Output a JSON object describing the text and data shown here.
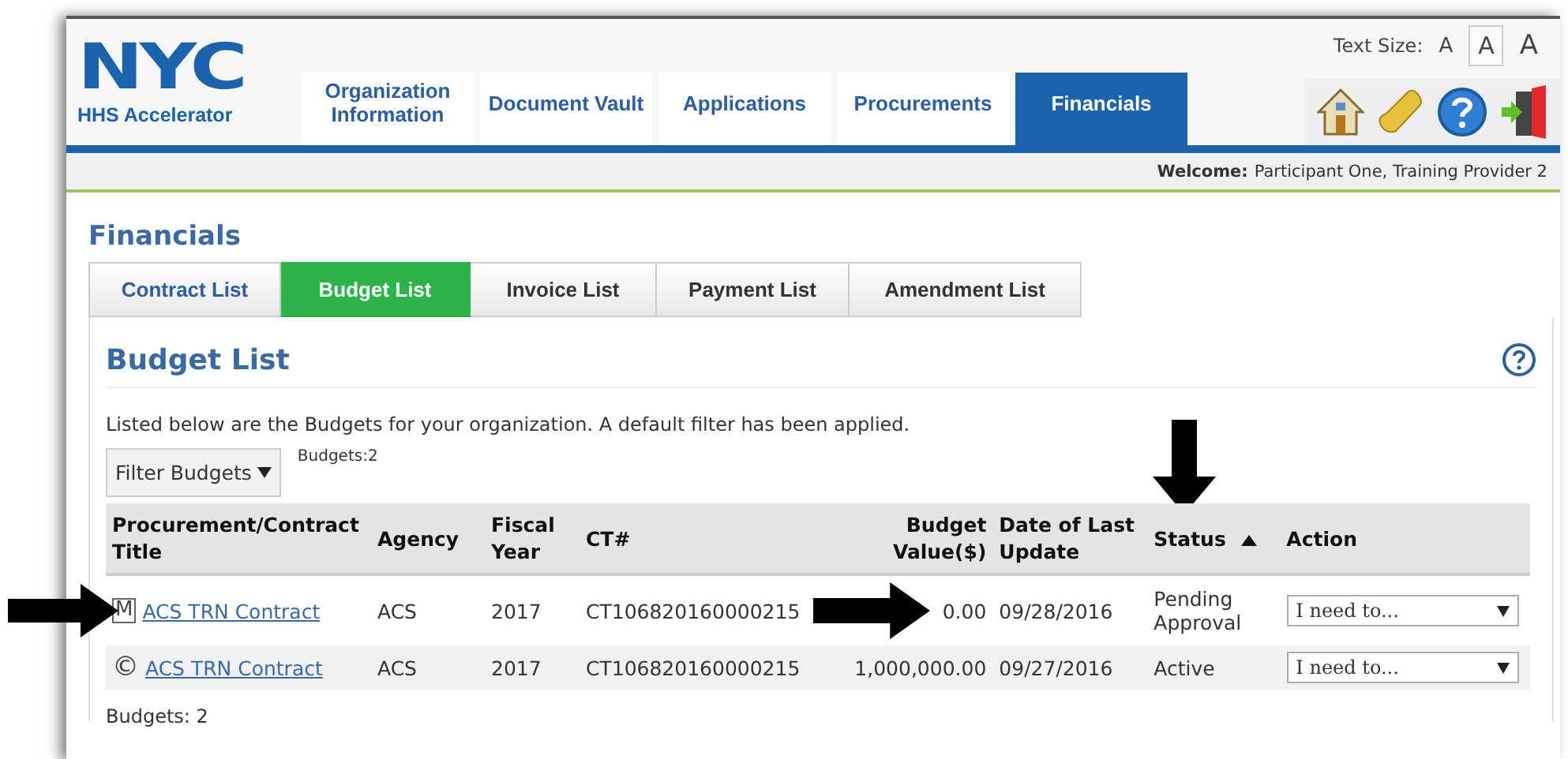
{
  "header": {
    "logo": {
      "mark": "NYC",
      "subtitle": "HHS Accelerator"
    },
    "text_size": {
      "label": "Text Size:",
      "options": [
        {
          "label": "A",
          "selected": false
        },
        {
          "label": "A",
          "selected": true
        },
        {
          "label": "A",
          "selected": false
        }
      ]
    },
    "nav_tabs": [
      {
        "label": "Organization Information",
        "selected": false
      },
      {
        "label": "Document Vault",
        "selected": false
      },
      {
        "label": "Applications",
        "selected": false
      },
      {
        "label": "Procurements",
        "selected": false
      },
      {
        "label": "Financials",
        "selected": true
      }
    ],
    "welcome": {
      "label": "Welcome:",
      "name": "Participant One,  Training Provider 2"
    }
  },
  "page_title": "Financials",
  "sub_tabs": [
    {
      "label": "Contract List",
      "selected": false
    },
    {
      "label": "Budget List",
      "selected": true
    },
    {
      "label": "Invoice List",
      "selected": false
    },
    {
      "label": "Payment List",
      "selected": false
    },
    {
      "label": "Amendment List",
      "selected": false
    }
  ],
  "section": {
    "title": "Budget List",
    "intro": "Listed below are the Budgets for your organization. A default filter has been applied.",
    "filter_button": "Filter Budgets",
    "count": "Budgets:2"
  },
  "table": {
    "columns": [
      {
        "label": "Procurement/Contract Title",
        "sorted": false
      },
      {
        "label": "Agency",
        "sorted": false
      },
      {
        "label": "Fiscal Year",
        "sorted": false
      },
      {
        "label": "CT#",
        "sorted": false
      },
      {
        "label": "Budget Value($)",
        "sorted": false
      },
      {
        "label": "Date of Last Update",
        "sorted": false
      },
      {
        "label": "Status",
        "sorted": true
      },
      {
        "label": "Action",
        "sorted": false
      }
    ],
    "rows": [
      {
        "kind": "boxed",
        "mark": "M",
        "title": "ACS TRN Contract",
        "agency": "ACS",
        "fiscal_year": "2017",
        "ct": "CT106820160000215",
        "value": "0.00",
        "date": "09/28/2016",
        "status": "Pending Approval",
        "action": "I need to..."
      },
      {
        "kind": "circled",
        "mark": "©",
        "title": "ACS TRN Contract",
        "agency": "ACS",
        "fiscal_year": "2017",
        "ct": "CT106820160000215",
        "value": "1,000,000.00",
        "date": "09/27/2016",
        "status": "Active",
        "action": "I need to..."
      }
    ],
    "footer": "Budgets: 2"
  },
  "annotations": [
    {
      "kind": "right_arrow"
    },
    {
      "kind": "right_arrow"
    },
    {
      "kind": "down_arrow"
    }
  ]
}
